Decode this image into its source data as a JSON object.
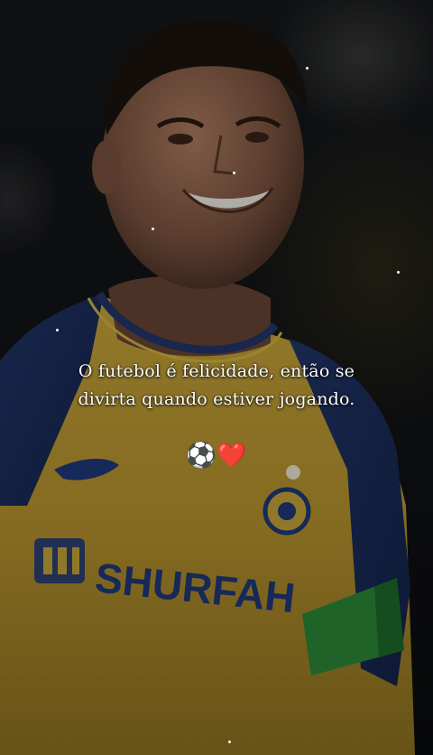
{
  "caption": {
    "line1": "O futebol é felicidade, então se",
    "line2": "divirta quando estiver jogando."
  },
  "emojis": {
    "ball": "⚽",
    "heart": "❤️"
  },
  "jersey": {
    "sponsor_text": "SHURFAH",
    "primary_color": "#d8b23a",
    "accent_color": "#1f3a7a"
  },
  "icons": [
    "soccer-ball-icon",
    "heart-icon",
    "club-crest-icon",
    "sponsor-logo-icon"
  ]
}
